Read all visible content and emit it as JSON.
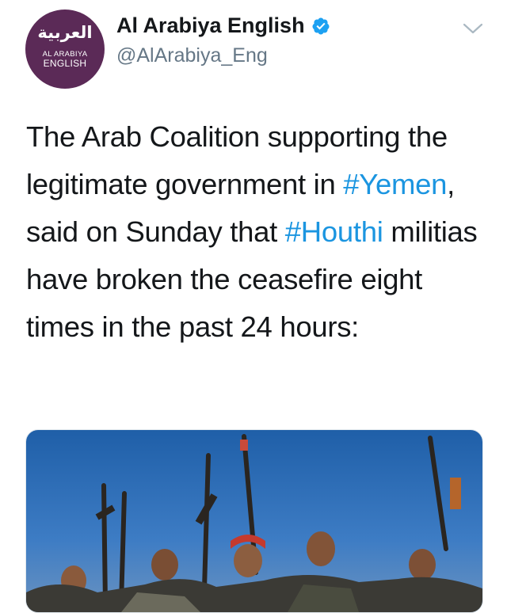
{
  "account": {
    "avatar_arabic": "العربية",
    "avatar_line1": "AL ARABIYA",
    "avatar_line2": "ENGLISH",
    "display_name": "Al Arabiya English",
    "handle": "@AlArabiya_Eng",
    "verified_icon": "verified-badge-icon"
  },
  "menu": {
    "icon": "chevron-down-icon"
  },
  "tweet": {
    "text_1": "The Arab Coalition supporting the legitimate government in ",
    "hashtag_1": "#Yemen",
    "text_2": ", said on Sunday that ",
    "hashtag_2": "#Houthi",
    "text_3": " militias have broken the ceasefire eight times in the past 24 hours:"
  },
  "colors": {
    "avatar_bg": "#5b2a57",
    "hashtag": "#1b95e0",
    "handle": "#657786",
    "verified": "#1da1f2"
  }
}
